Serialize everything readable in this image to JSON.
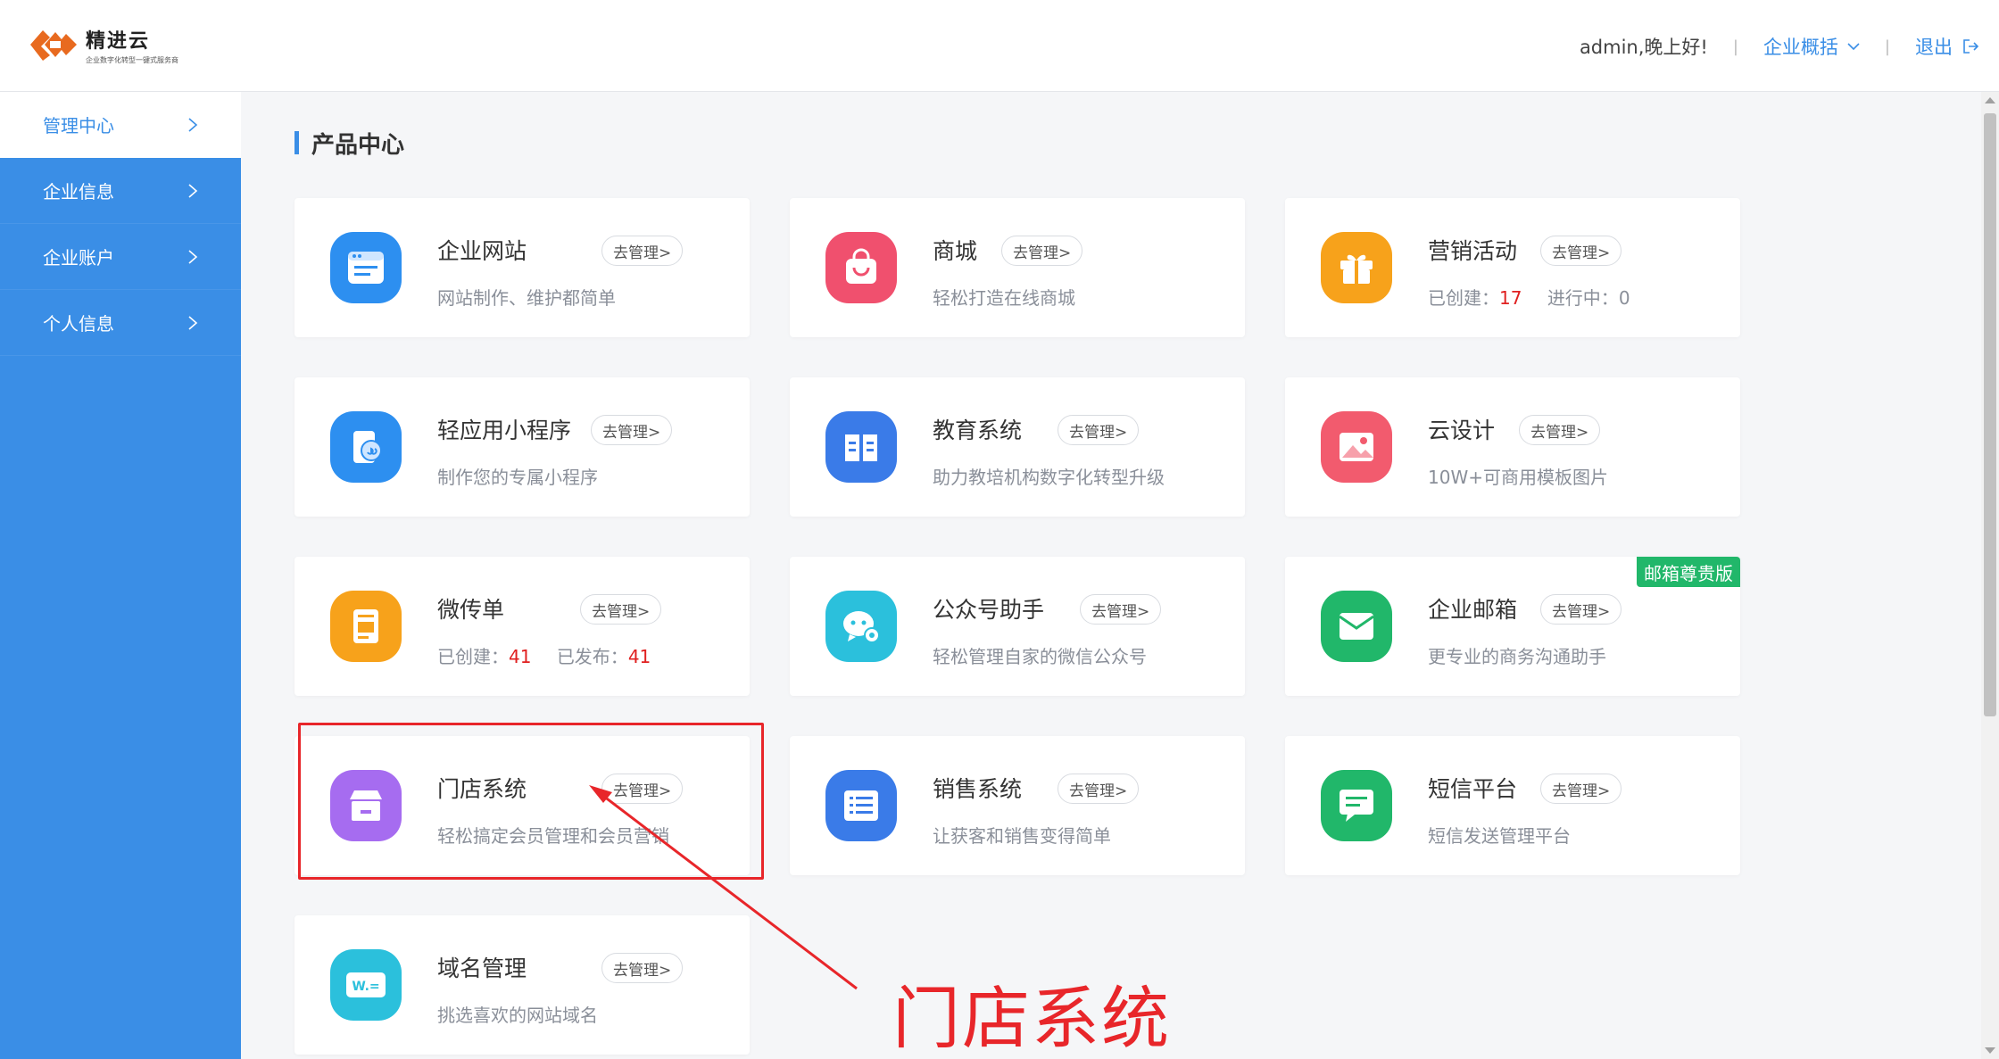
{
  "header": {
    "logo_name": "精进云",
    "logo_slogan": "企业数字化转型一键式服务商",
    "greeting": "admin,晚上好!",
    "overview_label": "企业概括",
    "logout_label": "退出"
  },
  "sidebar": {
    "items": [
      {
        "label": "管理中心"
      },
      {
        "label": "企业信息"
      },
      {
        "label": "企业账户"
      },
      {
        "label": "个人信息"
      }
    ]
  },
  "main": {
    "section_title": "产品中心",
    "manage_label": "去管理>",
    "cards": [
      {
        "name": "企业网站",
        "desc": "网站制作、维护都简单",
        "icon": "website-icon",
        "color": "#2d8ff0"
      },
      {
        "name": "商城",
        "desc": "轻松打造在线商城",
        "icon": "shopping-bag-icon",
        "color": "#f0506e"
      },
      {
        "name": "营销活动",
        "desc_label_1": "已创建：",
        "desc_value_1": "17",
        "desc_label_2": "进行中：",
        "desc_value_2": "0",
        "icon": "gift-icon",
        "color": "#f7a21b"
      },
      {
        "name": "轻应用小程序",
        "desc": "制作您的专属小程序",
        "icon": "mini-program-icon",
        "color": "#2d8ff0"
      },
      {
        "name": "教育系统",
        "desc": "助力教培机构数字化转型升级",
        "icon": "book-icon",
        "color": "#3a7be8"
      },
      {
        "name": "云设计",
        "desc": "10W+可商用模板图片",
        "icon": "image-icon",
        "color": "#f25b6e"
      },
      {
        "name": "微传单",
        "desc_label_1": "已创建：",
        "desc_value_1": "41",
        "desc_label_2": "已发布：",
        "desc_value_2": "41",
        "icon": "flyer-icon",
        "color": "#f7a21b"
      },
      {
        "name": "公众号助手",
        "desc": "轻松管理自家的微信公众号",
        "icon": "wechat-icon",
        "color": "#2bc0dc"
      },
      {
        "name": "企业邮箱",
        "desc": "更专业的商务沟通助手",
        "icon": "mail-icon",
        "color": "#21b76a",
        "badge": "邮箱尊贵版"
      },
      {
        "name": "门店系统",
        "desc": "轻松搞定会员管理和会员营销",
        "icon": "store-icon",
        "color": "#a66cf0"
      },
      {
        "name": "销售系统",
        "desc": "让获客和销售变得简单",
        "icon": "list-icon",
        "color": "#3a7be8"
      },
      {
        "name": "短信平台",
        "desc": "短信发送管理平台",
        "icon": "sms-icon",
        "color": "#21b76a"
      },
      {
        "name": "域名管理",
        "desc": "挑选喜欢的网站域名",
        "icon": "domain-icon",
        "color": "#2bc0dc"
      }
    ]
  },
  "annotation": {
    "text": "门店系统",
    "color": "#e8262a"
  },
  "colors": {
    "accent": "#3a8ee6",
    "highlight": "#e02020"
  }
}
